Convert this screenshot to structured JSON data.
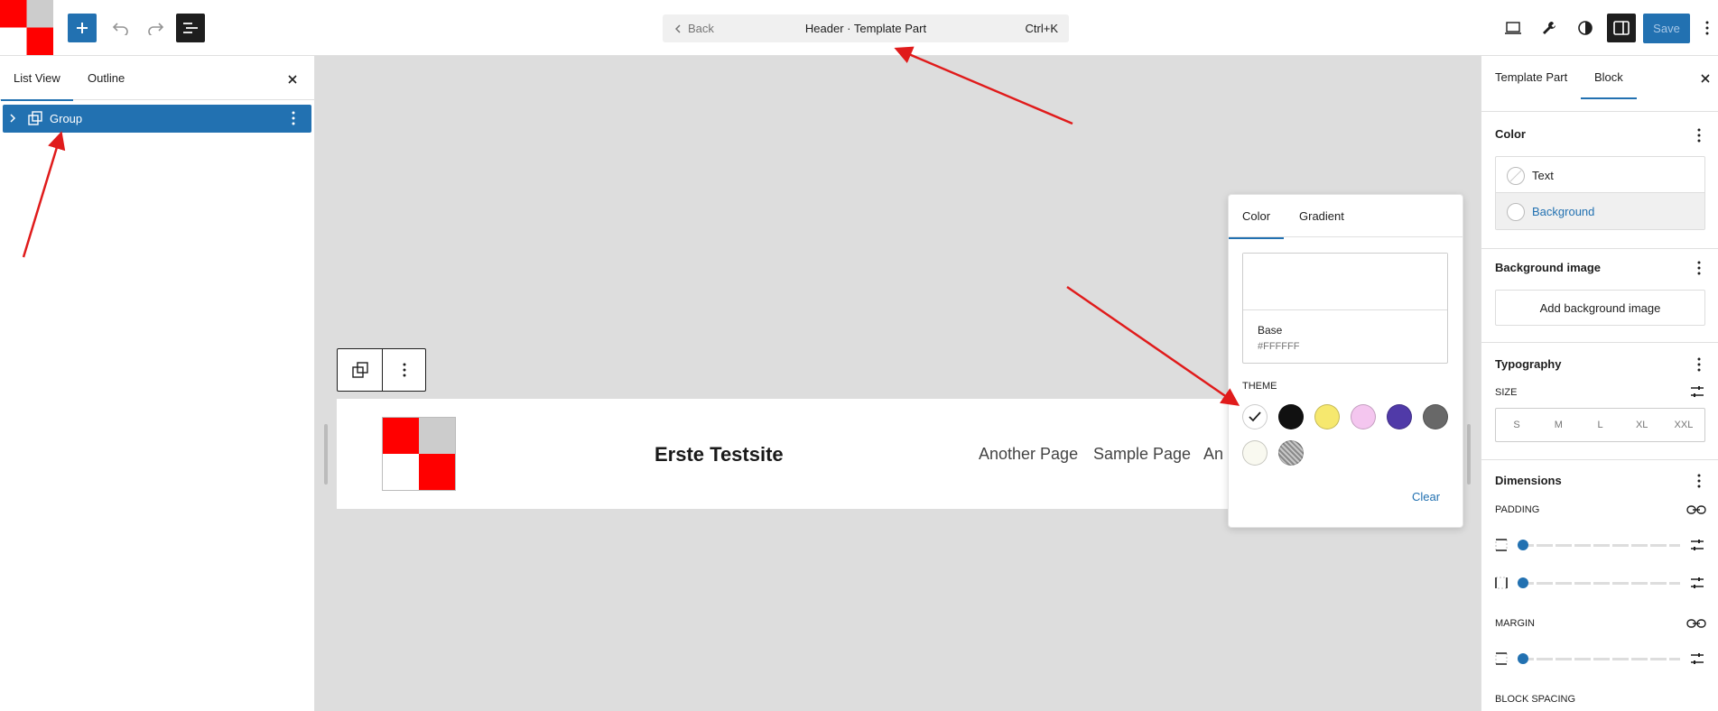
{
  "topbar": {
    "back_label": "Back",
    "document_title": "Header · Template Part",
    "shortcut": "Ctrl+K",
    "save_label": "Save"
  },
  "left_panel": {
    "tabs": [
      {
        "label": "List View"
      },
      {
        "label": "Outline"
      }
    ],
    "tree": [
      {
        "label": "Group"
      }
    ]
  },
  "canvas": {
    "site_title": "Erste Testsite",
    "nav_links": [
      "Another Page",
      "Sample Page",
      "An"
    ]
  },
  "color_popover": {
    "tabs": [
      {
        "label": "Color"
      },
      {
        "label": "Gradient"
      }
    ],
    "selected_name": "Base",
    "selected_hex": "#FFFFFF",
    "theme_label": "THEME",
    "swatches": [
      {
        "color": "#ffffff",
        "selected": true
      },
      {
        "color": "#111111"
      },
      {
        "color": "#f6e86e"
      },
      {
        "color": "#f4c6ef"
      },
      {
        "color": "#503aa8"
      },
      {
        "color": "#686868"
      },
      {
        "color": "#f9f9f0"
      },
      {
        "color": "pattern-gray"
      }
    ],
    "clear_label": "Clear"
  },
  "right_panel": {
    "tabs": [
      {
        "label": "Template Part"
      },
      {
        "label": "Block"
      }
    ],
    "color": {
      "title": "Color",
      "items": [
        {
          "label": "Text"
        },
        {
          "label": "Background"
        }
      ]
    },
    "background_image": {
      "title": "Background image",
      "button_label": "Add background image"
    },
    "typography": {
      "title": "Typography",
      "size_label": "SIZE",
      "sizes": [
        "S",
        "M",
        "L",
        "XL",
        "XXL"
      ]
    },
    "dimensions": {
      "title": "Dimensions",
      "padding_label": "PADDING",
      "margin_label": "MARGIN",
      "block_spacing_label": "BLOCK SPACING"
    }
  },
  "colors": {
    "accent": "#2271b1",
    "dark": "#1e1e1e",
    "logo_red": "#ff0000",
    "logo_gray": "#cccccc",
    "arrow_red": "#e01b1b"
  }
}
